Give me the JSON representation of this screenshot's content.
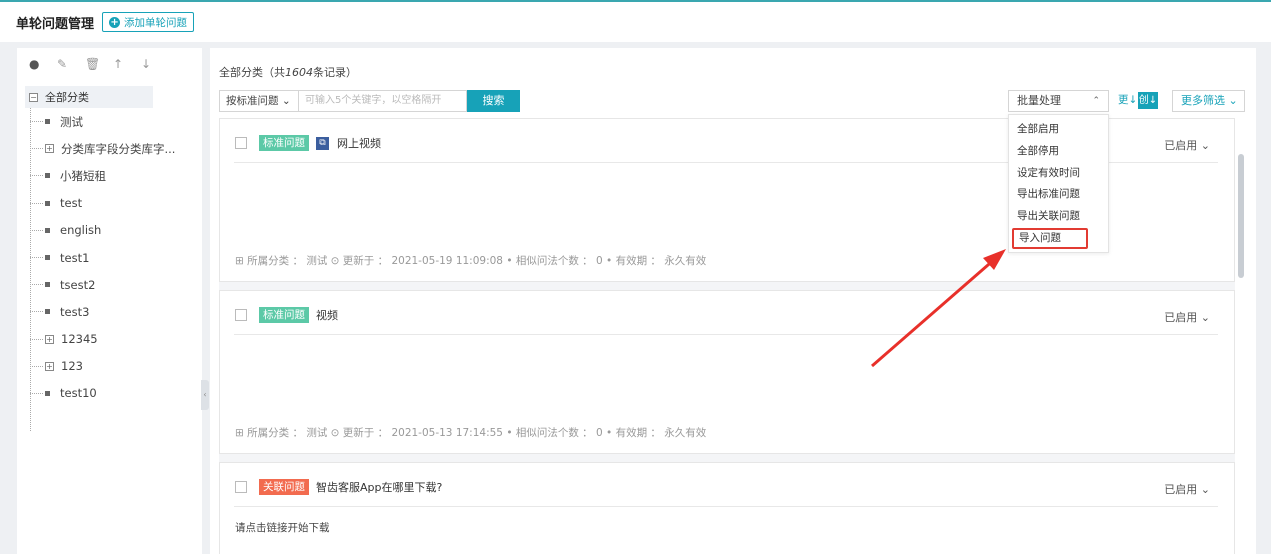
{
  "header": {
    "title": "单轮问题管理",
    "add_button": "添加单轮问题"
  },
  "sidebar": {
    "tools": [
      "add-icon",
      "edit-icon",
      "delete-icon",
      "move-up-icon",
      "move-down-icon"
    ],
    "root": "全部分类",
    "items": [
      "测试",
      "分类库字段分类库字...",
      "小猪短租",
      "test",
      "english",
      "test1",
      "tsest2",
      "test3",
      "12345",
      "123",
      "test10"
    ]
  },
  "main": {
    "summary_prefix": "全部分类（共",
    "summary_count": "1604",
    "summary_suffix": "条记录）",
    "search_mode": "按标准问题",
    "search_placeholder": "可输入5个关键字，以空格隔开",
    "search_button": "搜索",
    "batch_label": "批量处理",
    "sort_update": "更",
    "sort_create": "创",
    "more_filter": "更多筛选",
    "batch_menu": [
      "全部启用",
      "全部停用",
      "设定有效时间",
      "导出标准问题",
      "导出关联问题",
      "导入问题"
    ]
  },
  "cards": [
    {
      "tag": "标准问题",
      "title": "网上视频",
      "status": "已启用",
      "meta": "所属分类 ： 测试 ⊙ 更新于 ： 2021-05-19 11:09:08 • 相似问法个数 ： 0 • 有效期 ： 永久有效"
    },
    {
      "tag": "标准问题",
      "title": "视频",
      "status": "已启用",
      "meta": "所属分类 ： 测试 ⊙ 更新于 ： 2021-05-13 17:14:55 • 相似问法个数 ： 0 • 有效期 ： 永久有效"
    },
    {
      "tag": "关联问题",
      "title": "智齿客服App在哪里下载?",
      "status": "已启用",
      "answer": "请点击链接开始下载"
    }
  ],
  "colors": {
    "accent": "#17a2b8",
    "std_tag": "#5cc9a7",
    "rel_tag": "#f26b4f",
    "highlight": "#e23b32"
  }
}
